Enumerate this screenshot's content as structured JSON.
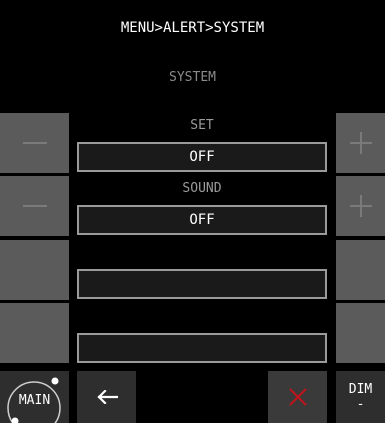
{
  "header": {
    "breadcrumb": "MENU>ALERT>SYSTEM",
    "subtitle": "SYSTEM"
  },
  "rows": [
    {
      "label": "SET",
      "value": "OFF"
    },
    {
      "label": "SOUND",
      "value": "OFF"
    },
    {
      "label": "",
      "value": ""
    },
    {
      "label": "",
      "value": ""
    }
  ],
  "footer": {
    "main_label": "MAIN",
    "dim_label": "DIM",
    "dim_value": "-"
  },
  "icons": {
    "minus": "minus-icon",
    "plus": "plus-icon",
    "back": "back-arrow-icon",
    "cancel": "cancel-x-icon"
  },
  "colors": {
    "side_button": "#5b5b5b",
    "footer_button": "#2e2e2e",
    "cancel_button": "#3a3a3a",
    "cancel_x": "#c0141c",
    "value_border": "#9a9a9a"
  }
}
